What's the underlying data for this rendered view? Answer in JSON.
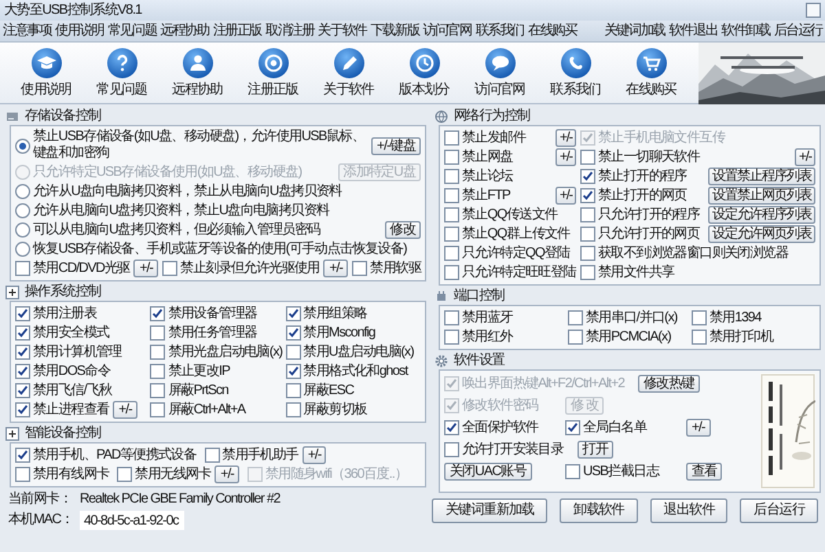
{
  "window": {
    "title": "大势至USB控制系统V8.1"
  },
  "menu": {
    "left": [
      "注意事项",
      "使用说明",
      "常见问题",
      "远程协助",
      "注册正版",
      "取消注册",
      "关于软件",
      "下载新版",
      "访问官网",
      "联系我们",
      "在线购买"
    ],
    "right": [
      "关键词加载",
      "软件退出",
      "软件卸载",
      "后台运行"
    ]
  },
  "toolbar": [
    {
      "label": "使用说明"
    },
    {
      "label": "常见问题"
    },
    {
      "label": "远程协助"
    },
    {
      "label": "注册正版"
    },
    {
      "label": "关于软件"
    },
    {
      "label": "版本划分"
    },
    {
      "label": "访问官网"
    },
    {
      "label": "联系我们"
    },
    {
      "label": "在线购买"
    }
  ],
  "left": {
    "sections": [
      {
        "kind": "storage",
        "title": "存储设备控制",
        "rows": [
          [
            [
              {
                "kind": "radio",
                "label": "禁止USB存储设备(如U盘、移动硬盘)，允许使用USB鼠标、键盘和加密狗",
                "selected": true,
                "disabled": false
              },
              {
                "kind": "button",
                "label": "+/-键盘",
                "disabled": false
              }
            ]
          ],
          [
            [
              {
                "kind": "radio",
                "label": "只允许特定USB存储设备使用(如U盘、移动硬盘)",
                "selected": false,
                "disabled": true
              },
              {
                "kind": "button",
                "label": "添加特定U盘",
                "disabled": true
              }
            ]
          ],
          [
            [
              {
                "kind": "radio",
                "label": "允许从U盘向电脑拷贝资料，禁止从电脑向U盘拷贝资料",
                "selected": false,
                "disabled": false
              }
            ]
          ],
          [
            [
              {
                "kind": "radio",
                "label": "允许从电脑向U盘拷贝资料，禁止U盘向电脑拷贝资料",
                "selected": false,
                "disabled": false
              }
            ]
          ],
          [
            [
              {
                "kind": "radio",
                "label": "可以从电脑向U盘拷贝资料，但必须输入管理员密码",
                "selected": false,
                "disabled": false
              },
              {
                "kind": "button",
                "label": "修改",
                "disabled": false
              }
            ]
          ],
          [
            [
              {
                "kind": "radio",
                "label": "恢复USB存储设备、手机或蓝牙等设备的使用(可手动点击恢复设备)",
                "selected": false,
                "disabled": false
              }
            ]
          ],
          [
            [
              {
                "kind": "checkbox",
                "label": "禁用CD/DVD光驱",
                "checked": false,
                "disabled": false
              },
              {
                "kind": "button",
                "label": "+/-",
                "disabled": false
              },
              {
                "kind": "checkbox",
                "label": "禁止刻录但允许光驱使用",
                "checked": false,
                "disabled": false
              },
              {
                "kind": "button",
                "label": "+/-",
                "disabled": false
              },
              {
                "kind": "checkbox",
                "label": "禁用软驱",
                "checked": false,
                "disabled": false
              }
            ]
          ]
        ]
      },
      {
        "kind": "os",
        "title": "操作系统控制",
        "rows": [
          [
            [
              {
                "kind": "checkbox",
                "label": "禁用注册表",
                "checked": true,
                "disabled": false
              }
            ],
            [
              {
                "kind": "checkbox",
                "label": "禁用设备管理器",
                "checked": true,
                "disabled": false
              }
            ],
            [
              {
                "kind": "checkbox",
                "label": "禁用组策略",
                "checked": true,
                "disabled": false
              }
            ]
          ],
          [
            [
              {
                "kind": "checkbox",
                "label": "禁用安全模式",
                "checked": true,
                "disabled": false
              }
            ],
            [
              {
                "kind": "checkbox",
                "label": "禁用任务管理器",
                "checked": false,
                "disabled": false
              }
            ],
            [
              {
                "kind": "checkbox",
                "label": "禁用Msconfig",
                "checked": true,
                "disabled": false
              }
            ]
          ],
          [
            [
              {
                "kind": "checkbox",
                "label": "禁用计算机管理",
                "checked": true,
                "disabled": false
              }
            ],
            [
              {
                "kind": "checkbox",
                "label": "禁用光盘启动电脑(x)",
                "checked": false,
                "disabled": false
              }
            ],
            [
              {
                "kind": "checkbox",
                "label": "禁用U盘启动电脑(x)",
                "checked": false,
                "disabled": false
              }
            ]
          ],
          [
            [
              {
                "kind": "checkbox",
                "label": "禁用DOS命令",
                "checked": true,
                "disabled": false
              }
            ],
            [
              {
                "kind": "checkbox",
                "label": "禁止更改IP",
                "checked": false,
                "disabled": false
              }
            ],
            [
              {
                "kind": "checkbox",
                "label": "禁用格式化和ghost",
                "checked": true,
                "disabled": false
              }
            ]
          ],
          [
            [
              {
                "kind": "checkbox",
                "label": "禁用飞信/飞秋",
                "checked": true,
                "disabled": false
              }
            ],
            [
              {
                "kind": "checkbox",
                "label": "屏蔽PrtScn",
                "checked": false,
                "disabled": false
              }
            ],
            [
              {
                "kind": "checkbox",
                "label": "屏蔽ESC",
                "checked": false,
                "disabled": false
              }
            ]
          ],
          [
            [
              {
                "kind": "checkbox",
                "label": "禁止进程查看",
                "checked": true,
                "disabled": false
              },
              {
                "kind": "button",
                "label": "+/-",
                "disabled": false
              }
            ],
            [
              {
                "kind": "checkbox",
                "label": "屏蔽Ctrl+Alt+A",
                "checked": false,
                "disabled": false
              }
            ],
            [
              {
                "kind": "checkbox",
                "label": "屏蔽剪切板",
                "checked": false,
                "disabled": false
              }
            ]
          ]
        ]
      },
      {
        "kind": "device",
        "title": "智能设备控制",
        "rows": [
          [
            [
              {
                "kind": "checkbox",
                "label": "禁用手机、PAD等便携式设备",
                "checked": true,
                "disabled": false
              }
            ],
            [
              {
                "kind": "checkbox",
                "label": "禁用手机助手",
                "checked": false,
                "disabled": false
              },
              {
                "kind": "button",
                "label": "+/-",
                "disabled": false
              }
            ]
          ],
          [
            [
              {
                "kind": "checkbox",
                "label": "禁用有线网卡",
                "checked": false,
                "disabled": false
              }
            ],
            [
              {
                "kind": "checkbox",
                "label": "禁用无线网卡",
                "checked": false,
                "disabled": false
              },
              {
                "kind": "button",
                "label": "+/-",
                "disabled": false
              }
            ],
            [
              {
                "kind": "checkbox",
                "label": "禁用随身wifi（360百度..）",
                "checked": false,
                "disabled": true
              }
            ]
          ]
        ]
      }
    ],
    "nic": {
      "label": "当前网卡：",
      "value": "Realtek PCIe GBE Family Controller #2"
    },
    "mac": {
      "label": "本机MAC：",
      "value": "40-8d-5c-a1-92-0c"
    }
  },
  "right": {
    "sections": [
      {
        "kind": "network",
        "title": "网络行为控制",
        "rows": [
          [
            [
              {
                "kind": "checkbox",
                "label": "禁止发邮件",
                "checked": false,
                "disabled": false
              },
              {
                "kind": "button",
                "label": "+/-",
                "disabled": false
              }
            ],
            [
              {
                "kind": "checkbox",
                "label": "禁止手机电脑文件互传",
                "checked": true,
                "disabled": true
              }
            ]
          ],
          [
            [
              {
                "kind": "checkbox",
                "label": "禁止网盘",
                "checked": false,
                "disabled": false
              },
              {
                "kind": "button",
                "label": "+/-",
                "disabled": false
              }
            ],
            [
              {
                "kind": "checkbox",
                "label": "禁止一切聊天软件",
                "checked": false,
                "disabled": false
              },
              {
                "kind": "button",
                "label": "+/-",
                "disabled": false
              }
            ]
          ],
          [
            [
              {
                "kind": "checkbox",
                "label": "禁止论坛",
                "checked": false,
                "disabled": false
              }
            ],
            [
              {
                "kind": "checkbox",
                "label": "禁止打开的程序",
                "checked": true,
                "disabled": false
              },
              {
                "kind": "button",
                "label": "设置禁止程序列表",
                "disabled": false
              }
            ]
          ],
          [
            [
              {
                "kind": "checkbox",
                "label": "禁止FTP",
                "checked": false,
                "disabled": false
              },
              {
                "kind": "button",
                "label": "+/-",
                "disabled": false
              }
            ],
            [
              {
                "kind": "checkbox",
                "label": "禁止打开的网页",
                "checked": true,
                "disabled": false
              },
              {
                "kind": "button",
                "label": "设置禁止网页列表",
                "disabled": false
              }
            ]
          ],
          [
            [
              {
                "kind": "checkbox",
                "label": "禁止QQ传送文件",
                "checked": false,
                "disabled": false
              }
            ],
            [
              {
                "kind": "checkbox",
                "label": "只允许打开的程序",
                "checked": false,
                "disabled": false
              },
              {
                "kind": "button",
                "label": "设定允许程序列表",
                "disabled": false
              }
            ]
          ],
          [
            [
              {
                "kind": "checkbox",
                "label": "禁止QQ群上传文件",
                "checked": false,
                "disabled": false
              }
            ],
            [
              {
                "kind": "checkbox",
                "label": "只允许打开的网页",
                "checked": false,
                "disabled": false
              },
              {
                "kind": "button",
                "label": "设定允许网页列表",
                "disabled": false
              }
            ]
          ],
          [
            [
              {
                "kind": "checkbox",
                "label": "只允许特定QQ登陆",
                "checked": false,
                "disabled": false
              }
            ],
            [
              {
                "kind": "checkbox",
                "label": "获取不到浏览器窗口则关闭浏览器",
                "checked": false,
                "disabled": false
              }
            ]
          ],
          [
            [
              {
                "kind": "checkbox",
                "label": "只允许特定旺旺登陆",
                "checked": false,
                "disabled": false
              }
            ],
            [
              {
                "kind": "checkbox",
                "label": "禁用文件共享",
                "checked": false,
                "disabled": false
              }
            ]
          ]
        ]
      },
      {
        "kind": "port",
        "title": "端口控制",
        "rows": [
          [
            [
              {
                "kind": "checkbox",
                "label": "禁用蓝牙",
                "checked": false,
                "disabled": false
              }
            ],
            [
              {
                "kind": "checkbox",
                "label": "禁用串口/并口(x)",
                "checked": false,
                "disabled": false
              }
            ],
            [
              {
                "kind": "checkbox",
                "label": "禁用1394",
                "checked": false,
                "disabled": false
              }
            ]
          ],
          [
            [
              {
                "kind": "checkbox",
                "label": "禁用红外",
                "checked": false,
                "disabled": false
              }
            ],
            [
              {
                "kind": "checkbox",
                "label": "禁用PCMCIA(x)",
                "checked": false,
                "disabled": false
              }
            ],
            [
              {
                "kind": "checkbox",
                "label": "禁用打印机",
                "checked": false,
                "disabled": false
              }
            ]
          ]
        ]
      },
      {
        "kind": "settings",
        "title": "软件设置",
        "rows": [
          [
            [
              {
                "kind": "checkbox",
                "label": "唤出界面热键Alt+F2/Ctrl+Alt+2",
                "checked": true,
                "disabled": true
              }
            ],
            [
              {
                "kind": "button",
                "label": "修改热键",
                "disabled": false
              }
            ]
          ],
          [
            [
              {
                "kind": "checkbox",
                "label": "修改软件密码",
                "checked": true,
                "disabled": true
              }
            ],
            [
              {
                "kind": "button",
                "label": "修 改",
                "disabled": true
              }
            ]
          ],
          [
            [
              {
                "kind": "checkbox",
                "label": "全面保护软件",
                "checked": true,
                "disabled": false
              }
            ],
            [
              {
                "kind": "checkbox",
                "label": "全局白名单",
                "checked": true,
                "disabled": false
              }
            ],
            [
              {
                "kind": "button",
                "label": "+/-",
                "disabled": false
              }
            ]
          ],
          [
            [
              {
                "kind": "checkbox",
                "label": "允许打开安装目录",
                "checked": false,
                "disabled": false
              }
            ],
            [
              {
                "kind": "button",
                "label": "打开",
                "disabled": false
              }
            ]
          ],
          [
            [
              {
                "kind": "button",
                "label": "关闭UAC账号",
                "disabled": false
              }
            ],
            [
              {
                "kind": "checkbox",
                "label": "USB拦截日志",
                "checked": false,
                "disabled": false
              }
            ],
            [
              {
                "kind": "button",
                "label": "查看",
                "disabled": false
              }
            ]
          ]
        ]
      }
    ],
    "buttons": [
      "关键词重新加载",
      "卸载软件",
      "退出软件",
      "后台运行"
    ]
  }
}
